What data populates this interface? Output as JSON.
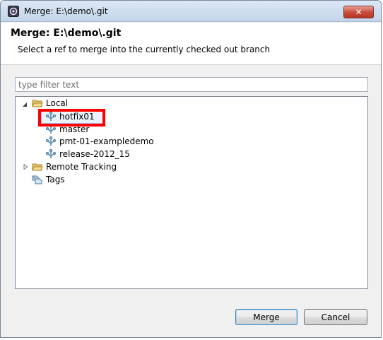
{
  "window": {
    "title": "Merge: E:\\demo\\.git"
  },
  "header": {
    "title": "Merge: E:\\demo\\.git",
    "description": "Select a ref to merge into the currently checked out branch"
  },
  "filter": {
    "placeholder": "type filter text",
    "value": ""
  },
  "tree": {
    "local": {
      "label": "Local",
      "expanded": true,
      "branches": [
        "hotfix01",
        "master",
        "pmt-01-exampledemo",
        "release-2012_15"
      ],
      "selected": "hotfix01"
    },
    "remote_tracking": {
      "label": "Remote Tracking",
      "expanded": false
    },
    "tags": {
      "label": "Tags"
    }
  },
  "buttons": {
    "merge": "Merge",
    "cancel": "Cancel"
  },
  "colors": {
    "annotation": "#ff0000",
    "selection": "#eaf3fb"
  }
}
